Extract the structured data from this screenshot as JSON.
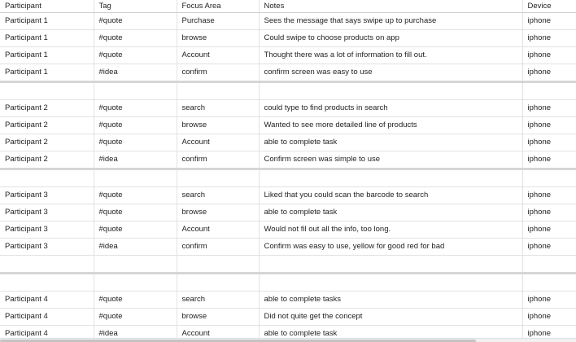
{
  "sheet": {
    "headers": [
      "Participant",
      "Tag",
      "Focus Area",
      "Notes",
      "Device"
    ],
    "rows": [
      [
        "Participant 1",
        "#quote",
        "Purchase",
        "Sees the message that says swipe up to purchase",
        "iphone"
      ],
      [
        "Participant 1",
        "#quote",
        "browse",
        "Could swipe to choose products on app",
        "iphone"
      ],
      [
        "Participant 1",
        "#quote",
        "Account",
        "Thought there was a lot of information to fill out.",
        "iphone"
      ],
      [
        "Participant 1",
        "#idea",
        "confirm",
        "confirm screen was easy to use",
        "iphone"
      ],
      [
        "",
        "",
        "",
        "",
        ""
      ],
      [
        "Participant 2",
        "#quote",
        "search",
        "could type to find products in search",
        "iphone"
      ],
      [
        "Participant 2",
        "#quote",
        "browse",
        "Wanted to see more detailed line of products",
        "iphone"
      ],
      [
        "Participant 2",
        "#quote",
        "Account",
        "able to complete task",
        "iphone"
      ],
      [
        "Participant 2",
        "#idea",
        "confirm",
        "Confirm screen was simple to use",
        "iphone"
      ],
      [
        "",
        "",
        "",
        "",
        ""
      ],
      [
        "Participant 3",
        "#quote",
        "search",
        "Liked that you could scan the barcode to search",
        "iphone"
      ],
      [
        "Participant 3",
        "#quote",
        "browse",
        "able to complete task",
        "iphone"
      ],
      [
        "Participant 3",
        "#quote",
        "Account",
        "Would not fil out all the info, too long.",
        "iphone"
      ],
      [
        "Participant 3",
        "#idea",
        "confirm",
        "Confirm was easy to use, yellow for good red for bad",
        "iphone"
      ],
      [
        "",
        "",
        "",
        "",
        ""
      ],
      [
        "",
        "",
        "",
        "",
        ""
      ],
      [
        "Participant 4",
        "#quote",
        "search",
        "able to complete tasks",
        "iphone"
      ],
      [
        "Participant 4",
        "#quote",
        "browse",
        "Did not quite get the concept",
        "iphone"
      ],
      [
        "Participant 4",
        "#idea",
        "Account",
        "able to complete task",
        "iphone"
      ]
    ]
  }
}
